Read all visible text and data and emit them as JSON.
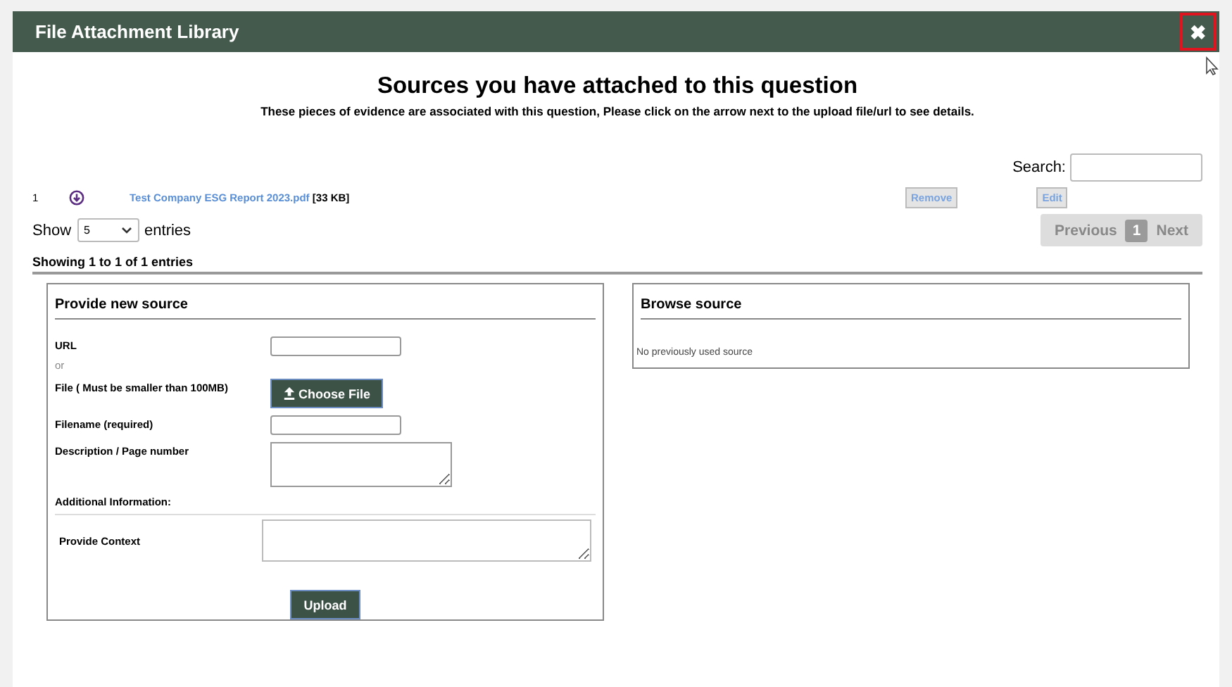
{
  "window": {
    "title": "File Attachment Library",
    "close_label": "✖"
  },
  "heading": "Sources you have attached to this question",
  "subheading": "These pieces of evidence are associated with this question, Please click on the arrow next to the upload file/url to see details.",
  "search": {
    "label": "Search:"
  },
  "attachments": [
    {
      "index": "1",
      "name": "Test Company ESG Report 2023.pdf",
      "size": "[33 KB]",
      "remove": "Remove",
      "edit": "Edit"
    }
  ],
  "length": {
    "before": "Show",
    "value": "5",
    "after": "entries"
  },
  "pagination": [
    {
      "label": "Previous",
      "selected": false
    },
    {
      "label": "1",
      "selected": true
    },
    {
      "label": "Next",
      "selected": false
    }
  ],
  "info": "Showing 1 to 1 of 1 entries",
  "new_source": {
    "title": "Provide new source",
    "fields": [
      {
        "kind": "input",
        "label": "URL"
      },
      {
        "kind": "note",
        "label": "or"
      },
      {
        "kind": "file",
        "label": "File ( Must be smaller than 100MB)",
        "button": "Choose File"
      },
      {
        "kind": "input",
        "label": "Filename (required)"
      },
      {
        "kind": "textarea",
        "label": "Description / Page number"
      }
    ],
    "additional": "Additional Information:",
    "context_label": "Provide Context",
    "upload": "Upload"
  },
  "browse": {
    "title": "Browse source",
    "empty": "No previously used source"
  }
}
